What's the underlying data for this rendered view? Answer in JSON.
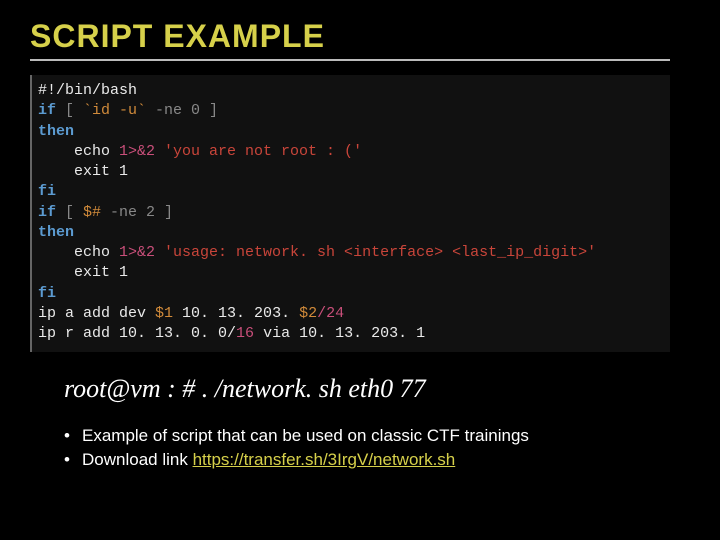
{
  "title": "SCRIPT EXAMPLE",
  "code": {
    "l1": "#!/bin/bash",
    "l2a": "if",
    "l2b": " [ ",
    "l2c": "`id -u`",
    "l2d": " -ne 0 ]",
    "l3": "then",
    "l4a": "    echo ",
    "l4b": "1>&2",
    "l4c": " 'you are not root : ('",
    "l5": "    exit 1",
    "l6": "fi",
    "l7a": "if",
    "l7b": " [ ",
    "l7c": "$#",
    "l7d": " -ne 2 ]",
    "l8": "then",
    "l9a": "    echo ",
    "l9b": "1>&2",
    "l9c": " 'usage: network. sh <interface> <last_ip_digit>'",
    "l10": "    exit 1",
    "l11": "fi",
    "l12a": "ip a add dev ",
    "l12b": "$1",
    "l12c": " 10. 13. 203. ",
    "l12d": "$2",
    "l12e": "/",
    "l12f": "24",
    "l13a": "ip r add 10. 13. 0. 0/",
    "l13b": "16",
    "l13c": " via 10. 13. 203. 1"
  },
  "command": "root@vm : # . /network. sh eth0 77",
  "bullets": [
    {
      "text": "Example of script that can be used on classic CTF trainings"
    },
    {
      "text": "Download link ",
      "link": "https://transfer.sh/3IrgV/network.sh"
    }
  ]
}
